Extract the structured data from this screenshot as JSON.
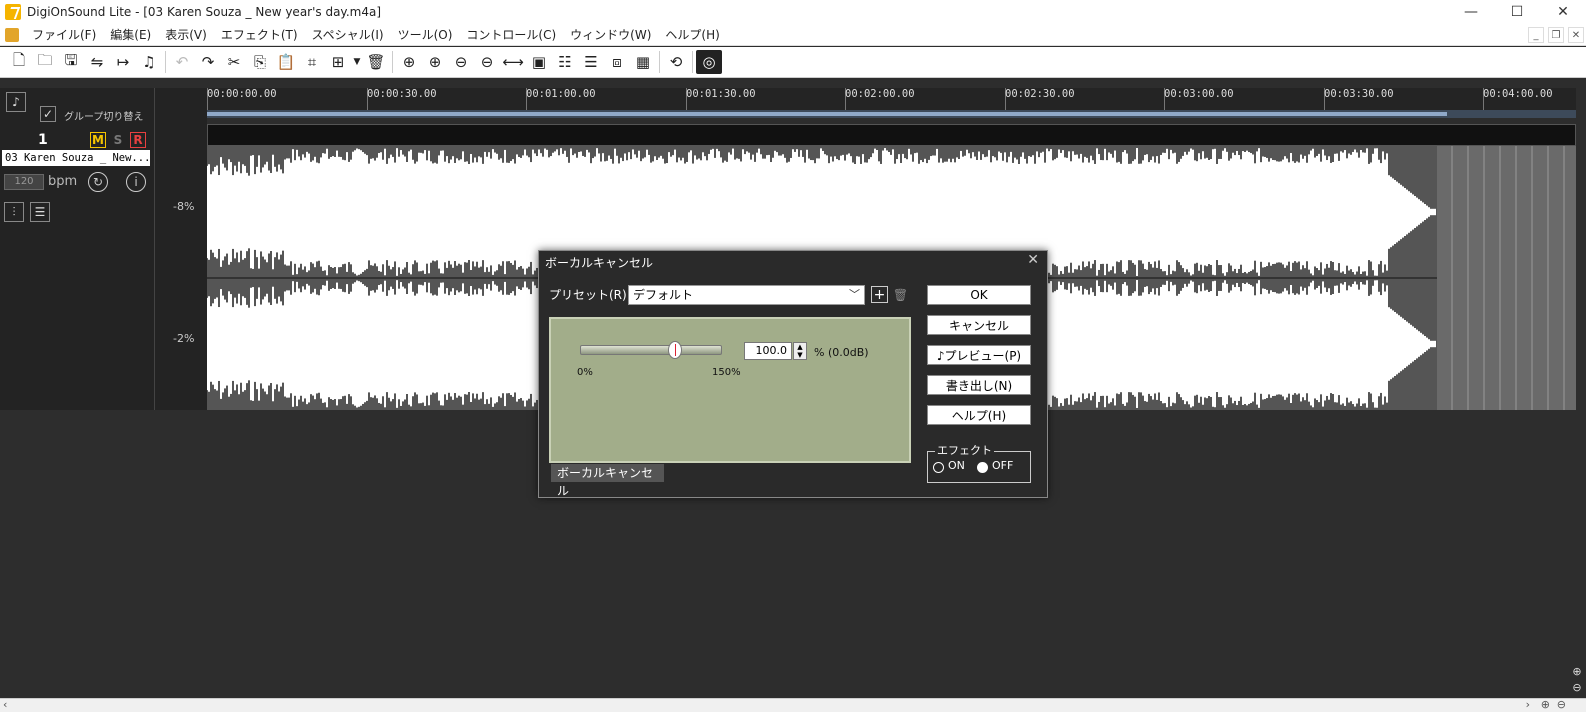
{
  "window": {
    "title": "DigiOnSound Lite - [03 Karen Souza _ New year's day.m4a]",
    "controls": [
      "—",
      "☐",
      "✕"
    ]
  },
  "menu": [
    "ファイル(F)",
    "編集(E)",
    "表示(V)",
    "エフェクト(T)",
    "スペシャル(I)",
    "ツール(O)",
    "コントロール(C)",
    "ウィンドウ(W)",
    "ヘルプ(H)"
  ],
  "timeline": {
    "ticks": [
      "00:00:00.00",
      "00:00:30.00",
      "00:01:00.00",
      "00:01:30.00",
      "00:02:00.00",
      "00:02:30.00",
      "00:03:00.00",
      "00:03:30.00",
      "00:04:00.00"
    ]
  },
  "track": {
    "group_toggle_label": "グループ切り替え",
    "number": "1",
    "mute": "M",
    "solo": "S",
    "record": "R",
    "name": "03 Karen Souza _ New...",
    "bpm_value": "120",
    "bpm_label": "bpm",
    "db_labels": [
      "-8%",
      "-2%"
    ]
  },
  "dialog": {
    "title": "ボーカルキャンセル",
    "preset_label": "プリセット(R):",
    "preset_value": "デフォルト",
    "slider_min": "0%",
    "slider_max": "150%",
    "amount_value": "100.0",
    "amount_unit": "% (0.0dB)",
    "amount_fraction": 0.667,
    "panel_tab": "ボーカルキャンセル",
    "buttons": {
      "ok": "OK",
      "cancel": "キャンセル",
      "preview": "♪プレビュー(P)",
      "export": "書き出し(N)",
      "help": "ヘルプ(H)"
    },
    "effect_group": "エフェクト",
    "effect_on": "ON",
    "effect_off": "OFF"
  }
}
